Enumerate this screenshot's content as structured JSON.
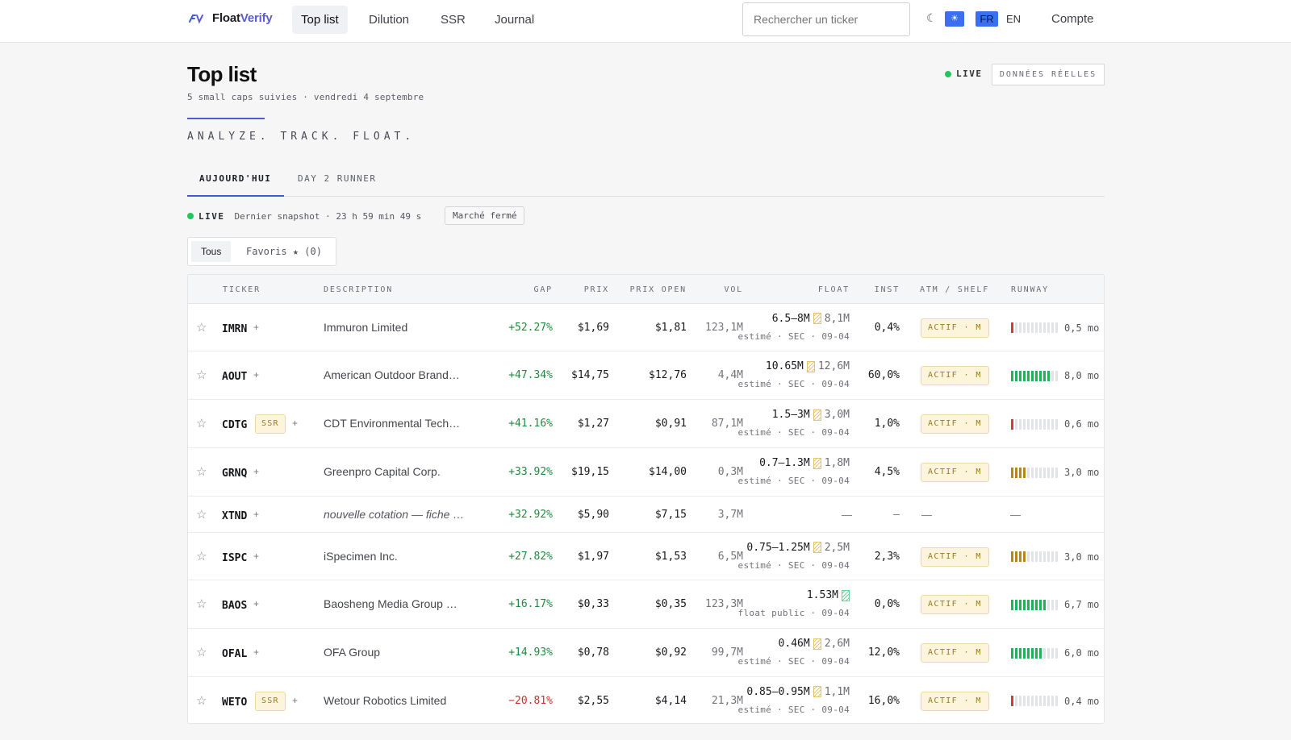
{
  "nav": {
    "brand_a": "Float",
    "brand_b": "Verify",
    "links": [
      "Top list",
      "Dilution",
      "SSR",
      "Journal"
    ],
    "search_placeholder": "Rechercher un ticker",
    "theme_dark_icon": "moon-icon",
    "theme_light_icon": "sun-icon",
    "lang_fr": "FR",
    "lang_en": "EN",
    "account": "Compte"
  },
  "header": {
    "title": "Top list",
    "subtitle": "5 small caps suivies · vendredi 4 septembre",
    "tagline": "ANALYZE. TRACK. FLOAT.",
    "live": "LIVE",
    "data_badge": "DONNÉES RÉELLES"
  },
  "tabs": [
    "AUJOURD'HUI",
    "DAY 2 RUNNER"
  ],
  "status": {
    "live": "LIVE",
    "snapshot": "Dernier snapshot · 23 h 59 min 49 s",
    "market": "Marché fermé"
  },
  "filters": {
    "all": "Tous",
    "favorites": "Favoris ★ (0)"
  },
  "columns": [
    "TICKER",
    "DESCRIPTION",
    "GAP",
    "PRIX",
    "PRIX OPEN",
    "VOL",
    "FLOAT",
    "INST",
    "ATM / SHELF",
    "RUNWAY"
  ],
  "colors": {
    "accent": "#3b6ff0",
    "brand": "#5b5bd6",
    "positive": "#1f8a3e",
    "negative": "#d22b2b",
    "runway_red": "#d43a3a",
    "runway_gold": "#b8861a",
    "runway_green": "#22b35a"
  },
  "rows": [
    {
      "star": "☆",
      "ticker": "IMRN",
      "ssr": "",
      "plus": "+",
      "desc": "Immuron Limited",
      "gap": "+52.27%",
      "gap_sign": "pos",
      "price": "$1,69",
      "open": "$1,81",
      "vol": "123,1M",
      "float_range": "6.5–8M",
      "float_sec": "8,1M",
      "float_src": "estimé · SEC · 09-04",
      "inst": "0,4%",
      "atm": "ACTIF · M",
      "runway_filled": 1,
      "runway_color": "red",
      "runway_val": "0,5 mo"
    },
    {
      "star": "☆",
      "ticker": "AOUT",
      "ssr": "",
      "plus": "+",
      "desc": "American Outdoor Brands, Inc.",
      "gap": "+47.34%",
      "gap_sign": "pos",
      "price": "$14,75",
      "open": "$12,76",
      "vol": "4,4M",
      "float_range": "10.65M",
      "float_sec": "12,6M",
      "float_src": "estimé · SEC · 09-04",
      "inst": "60,0%",
      "atm": "ACTIF · M",
      "runway_filled": 10,
      "runway_color": "green",
      "runway_val": "8,0 mo"
    },
    {
      "star": "☆",
      "ticker": "CDTG",
      "ssr": "SSR",
      "plus": "+",
      "desc": "CDT Environmental Technology",
      "gap": "+41.16%",
      "gap_sign": "pos",
      "price": "$1,27",
      "open": "$0,91",
      "vol": "87,1M",
      "float_range": "1.5–3M",
      "float_sec": "3,0M",
      "float_src": "estimé · SEC · 09-04",
      "inst": "1,0%",
      "atm": "ACTIF · M",
      "runway_filled": 1,
      "runway_color": "red",
      "runway_val": "0,6 mo"
    },
    {
      "star": "☆",
      "ticker": "GRNQ",
      "ssr": "",
      "plus": "+",
      "desc": "Greenpro Capital Corp.",
      "gap": "+33.92%",
      "gap_sign": "pos",
      "price": "$19,15",
      "open": "$14,00",
      "vol": "0,3M",
      "float_range": "0.7–1.3M",
      "float_sec": "1,8M",
      "float_src": "estimé · SEC · 09-04",
      "inst": "4,5%",
      "atm": "ACTIF · M",
      "runway_filled": 4,
      "runway_color": "gold",
      "runway_val": "3,0 mo"
    },
    {
      "star": "☆",
      "ticker": "XTND",
      "ssr": "",
      "plus": "+",
      "desc": "nouvelle cotation — fiche à venir",
      "desc_italic": true,
      "gap": "+32.92%",
      "gap_sign": "pos",
      "price": "$5,90",
      "open": "$7,15",
      "vol": "3,7M",
      "float_range": "",
      "float_sec": "",
      "float_src": "",
      "inst": "—",
      "atm": "",
      "runway_filled": 0,
      "runway_color": "",
      "runway_val": "",
      "empty": true,
      "dash": "—"
    },
    {
      "star": "☆",
      "ticker": "ISPC",
      "ssr": "",
      "plus": "+",
      "desc": "iSpecimen Inc.",
      "gap": "+27.82%",
      "gap_sign": "pos",
      "price": "$1,97",
      "open": "$1,53",
      "vol": "6,5M",
      "float_range": "0.75–1.25M",
      "float_sec": "2,5M",
      "float_src": "estimé · SEC · 09-04",
      "inst": "2,3%",
      "atm": "ACTIF · M",
      "runway_filled": 4,
      "runway_color": "gold",
      "runway_val": "3,0 mo"
    },
    {
      "star": "☆",
      "ticker": "BAOS",
      "ssr": "",
      "plus": "+",
      "desc": "Baosheng Media Group Holdings",
      "gap": "+16.17%",
      "gap_sign": "pos",
      "price": "$0,33",
      "open": "$0,35",
      "vol": "123,3M",
      "float_range": "1.53M",
      "float_sec": "",
      "float_src": "float public · 09-04",
      "float_green": true,
      "inst": "0,0%",
      "atm": "ACTIF · M",
      "runway_filled": 9,
      "runway_color": "green",
      "runway_val": "6,7 mo"
    },
    {
      "star": "☆",
      "ticker": "OFAL",
      "ssr": "",
      "plus": "+",
      "desc": "OFA Group",
      "gap": "+14.93%",
      "gap_sign": "pos",
      "price": "$0,78",
      "open": "$0,92",
      "vol": "99,7M",
      "float_range": "0.46M",
      "float_sec": "2,6M",
      "float_src": "estimé · SEC · 09-04",
      "inst": "12,0%",
      "atm": "ACTIF · M",
      "runway_filled": 8,
      "runway_color": "green",
      "runway_val": "6,0 mo"
    },
    {
      "star": "☆",
      "ticker": "WETO",
      "ssr": "SSR",
      "plus": "+",
      "desc": "Wetour Robotics Limited",
      "gap": "−20.81%",
      "gap_sign": "neg",
      "price": "$2,55",
      "open": "$4,14",
      "vol": "21,3M",
      "float_range": "0.85–0.95M",
      "float_sec": "1,1M",
      "float_src": "estimé · SEC · 09-04",
      "inst": "16,0%",
      "atm": "ACTIF · M",
      "runway_filled": 1,
      "runway_color": "red",
      "runway_val": "0,4 mo"
    }
  ]
}
